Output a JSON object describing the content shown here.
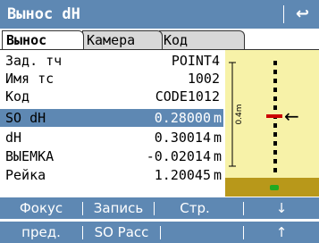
{
  "window": {
    "title": "Вынос dH",
    "back_icon": "↩"
  },
  "tabs": [
    {
      "label": "Вынос",
      "active": true
    },
    {
      "label": "Камера",
      "active": false
    },
    {
      "label": "Код",
      "active": false
    }
  ],
  "fields": [
    {
      "label": "Зад. тч",
      "value": "POINT4"
    },
    {
      "label": "Имя тс",
      "value": "1002"
    },
    {
      "label": "Код",
      "value": "CODE1012"
    },
    {
      "label": "SO dH",
      "value": "0.28000",
      "unit": "m"
    },
    {
      "label": "dH",
      "value": "0.30014",
      "unit": "m"
    },
    {
      "label": "ВЫЕМКА",
      "value": "-0.02014",
      "unit": "m"
    },
    {
      "label": "Рейка",
      "value": "1.20045",
      "unit": "m"
    }
  ],
  "graphic": {
    "scale_label": "0.4m",
    "arrow": "←",
    "colors": {
      "panel_bg": "#f7f2a8",
      "ground": "#b8981a",
      "target_marker": "#cc0000",
      "instrument": "#22aa22"
    }
  },
  "softkeys_row1": [
    "Фокус",
    "Запись",
    "Стр.",
    "",
    "↓"
  ],
  "softkeys_row2": [
    "пред.",
    "SO Расс",
    "",
    "",
    "↑"
  ],
  "colors": {
    "accent": "#5e88b3",
    "text": "#000000"
  }
}
